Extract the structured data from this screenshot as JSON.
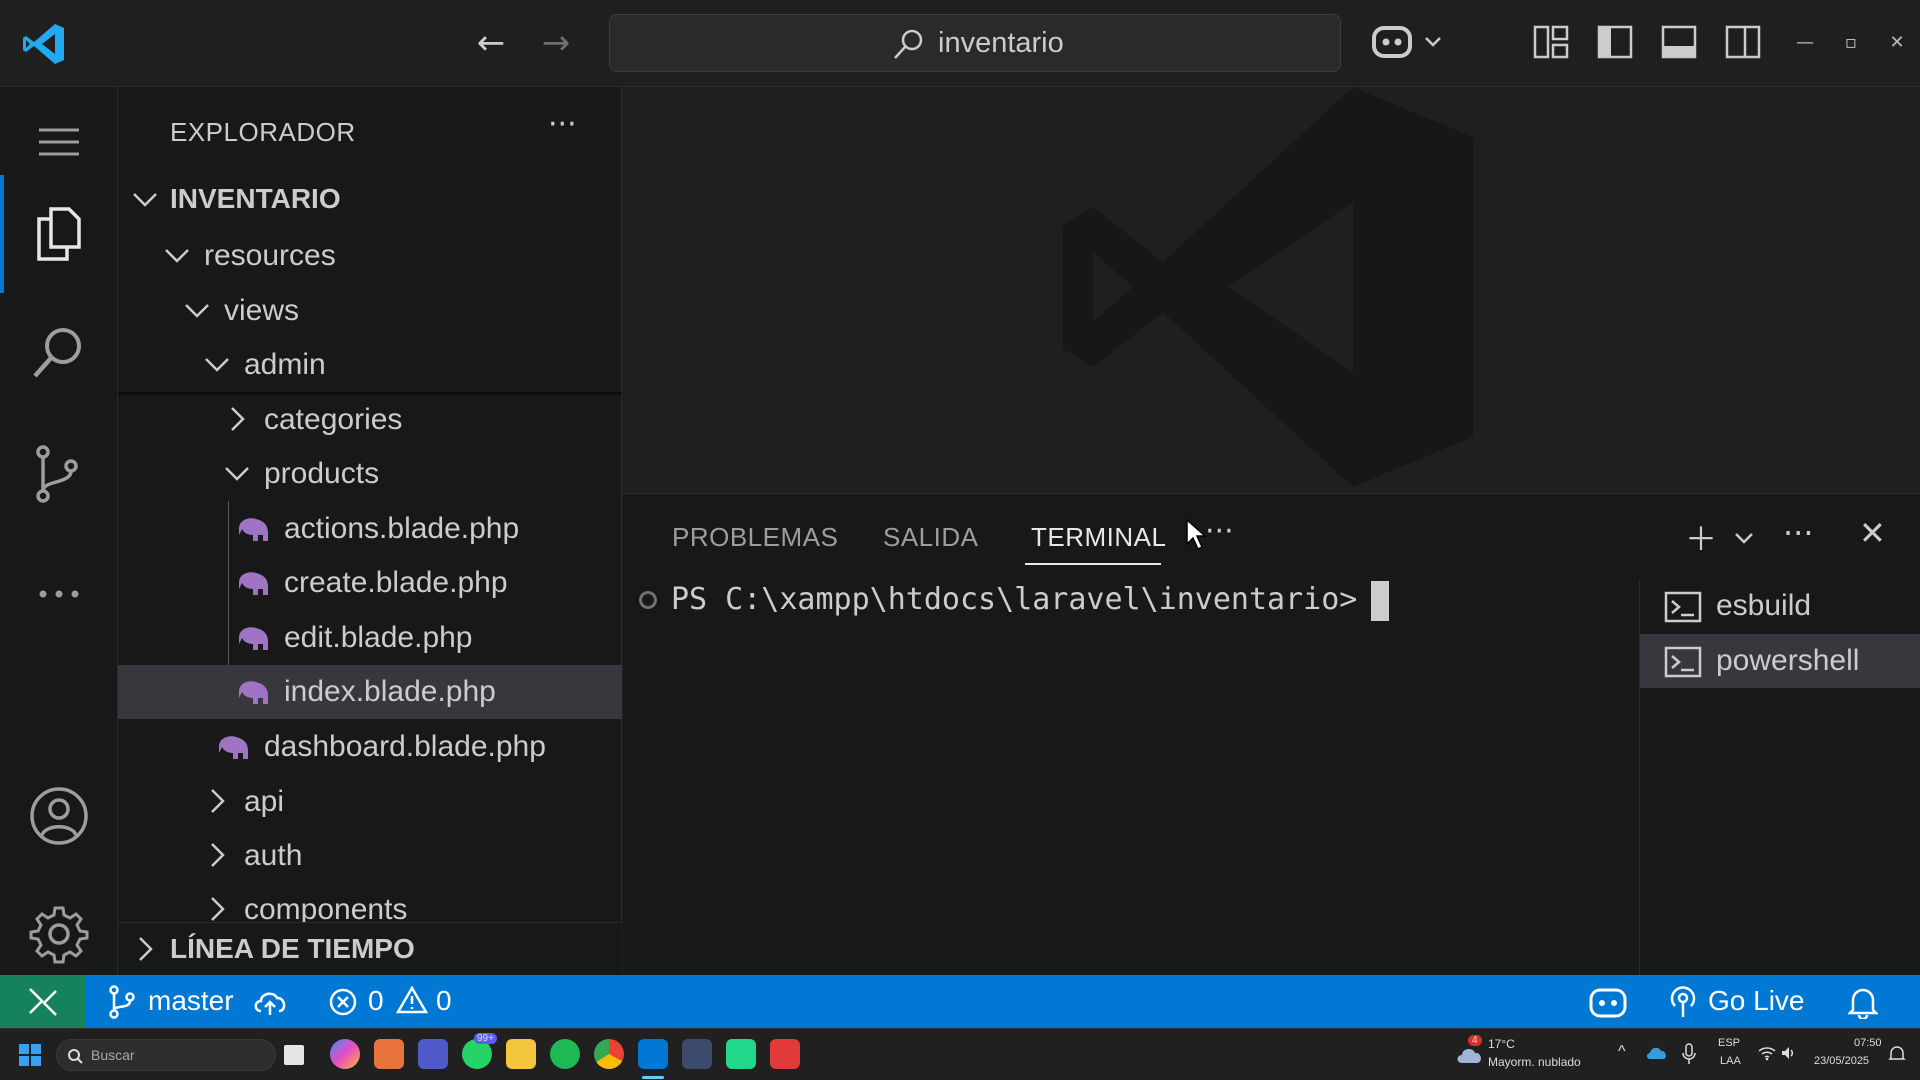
{
  "titlebar": {
    "search_text": "inventario"
  },
  "sidebar": {
    "title": "EXPLORADOR",
    "more": "···",
    "root": "INVENTARIO",
    "tree": {
      "resources": "resources",
      "views": "views",
      "admin": "admin",
      "categories": "categories",
      "products": "products",
      "actions": "actions.blade.php",
      "create": "create.blade.php",
      "edit": "edit.blade.php",
      "index": "index.blade.php",
      "dashboard": "dashboard.blade.php",
      "api": "api",
      "auth": "auth",
      "components": "components"
    },
    "timeline": "LÍNEA DE TIEMPO"
  },
  "panel": {
    "tabs": [
      "PROBLEMAS",
      "SALIDA",
      "TERMINAL"
    ],
    "active_tab": "TERMINAL",
    "more": "···",
    "prompt": "PS C:\\xampp\\htdocs\\laravel\\inventario>",
    "terminals": [
      "esbuild",
      "powershell"
    ],
    "selected_terminal": "powershell"
  },
  "statusbar": {
    "branch": "master",
    "errors": "0",
    "warnings": "0",
    "go_live": "Go Live"
  },
  "taskbar": {
    "search_placeholder": "Buscar",
    "weather_temp": "17°C",
    "weather_desc": "Mayorm. nublado",
    "weather_badge": "4",
    "chat_badge": "99+",
    "lang": "ESP",
    "layout": "LAA",
    "time": "07:50",
    "date": "23/05/2025"
  },
  "colors": {
    "accent": "#0078d4",
    "remote": "#16825d",
    "php": "#a074c4"
  }
}
